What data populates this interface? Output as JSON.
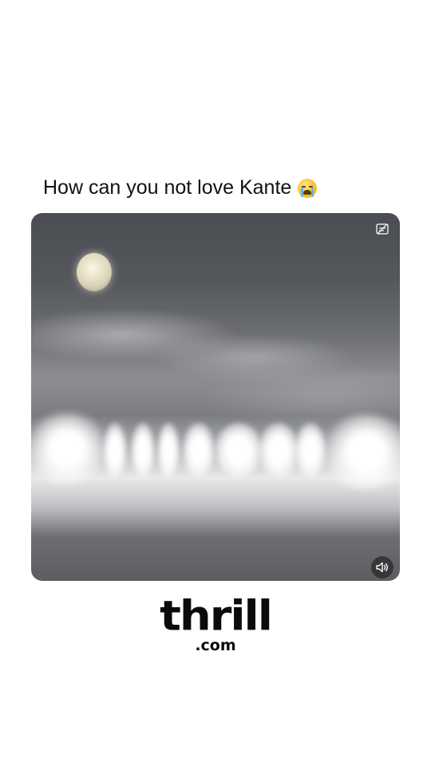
{
  "post": {
    "caption": "How can you not love Kante",
    "caption_emoji": "loudly-crying-face"
  },
  "video": {
    "controls": {
      "captions_toggle_icon": "captions-off-icon",
      "mute_icon": "speaker-volume-icon"
    }
  },
  "brand": {
    "name": "thrill",
    "domain": ".com"
  },
  "colors": {
    "background": "#ffffff",
    "text": "#111111",
    "brand": "#0b0b0b"
  }
}
